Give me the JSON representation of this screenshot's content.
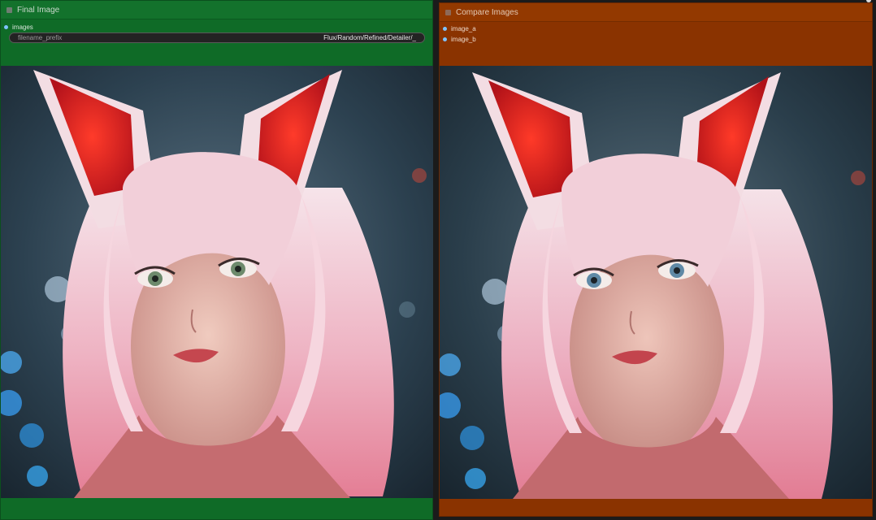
{
  "final_node": {
    "title": "Final Image",
    "input_slot": "images",
    "widget": {
      "label": "filename_prefix",
      "value": "Flux/Random/Refined/Detailer/_"
    },
    "image_icon": "portrait-image",
    "color": "#0f6b27"
  },
  "compare_node": {
    "title": "Compare Images",
    "slots": [
      "image_a",
      "image_b"
    ],
    "image_icon": "portrait-image",
    "color": "#8a3300"
  }
}
